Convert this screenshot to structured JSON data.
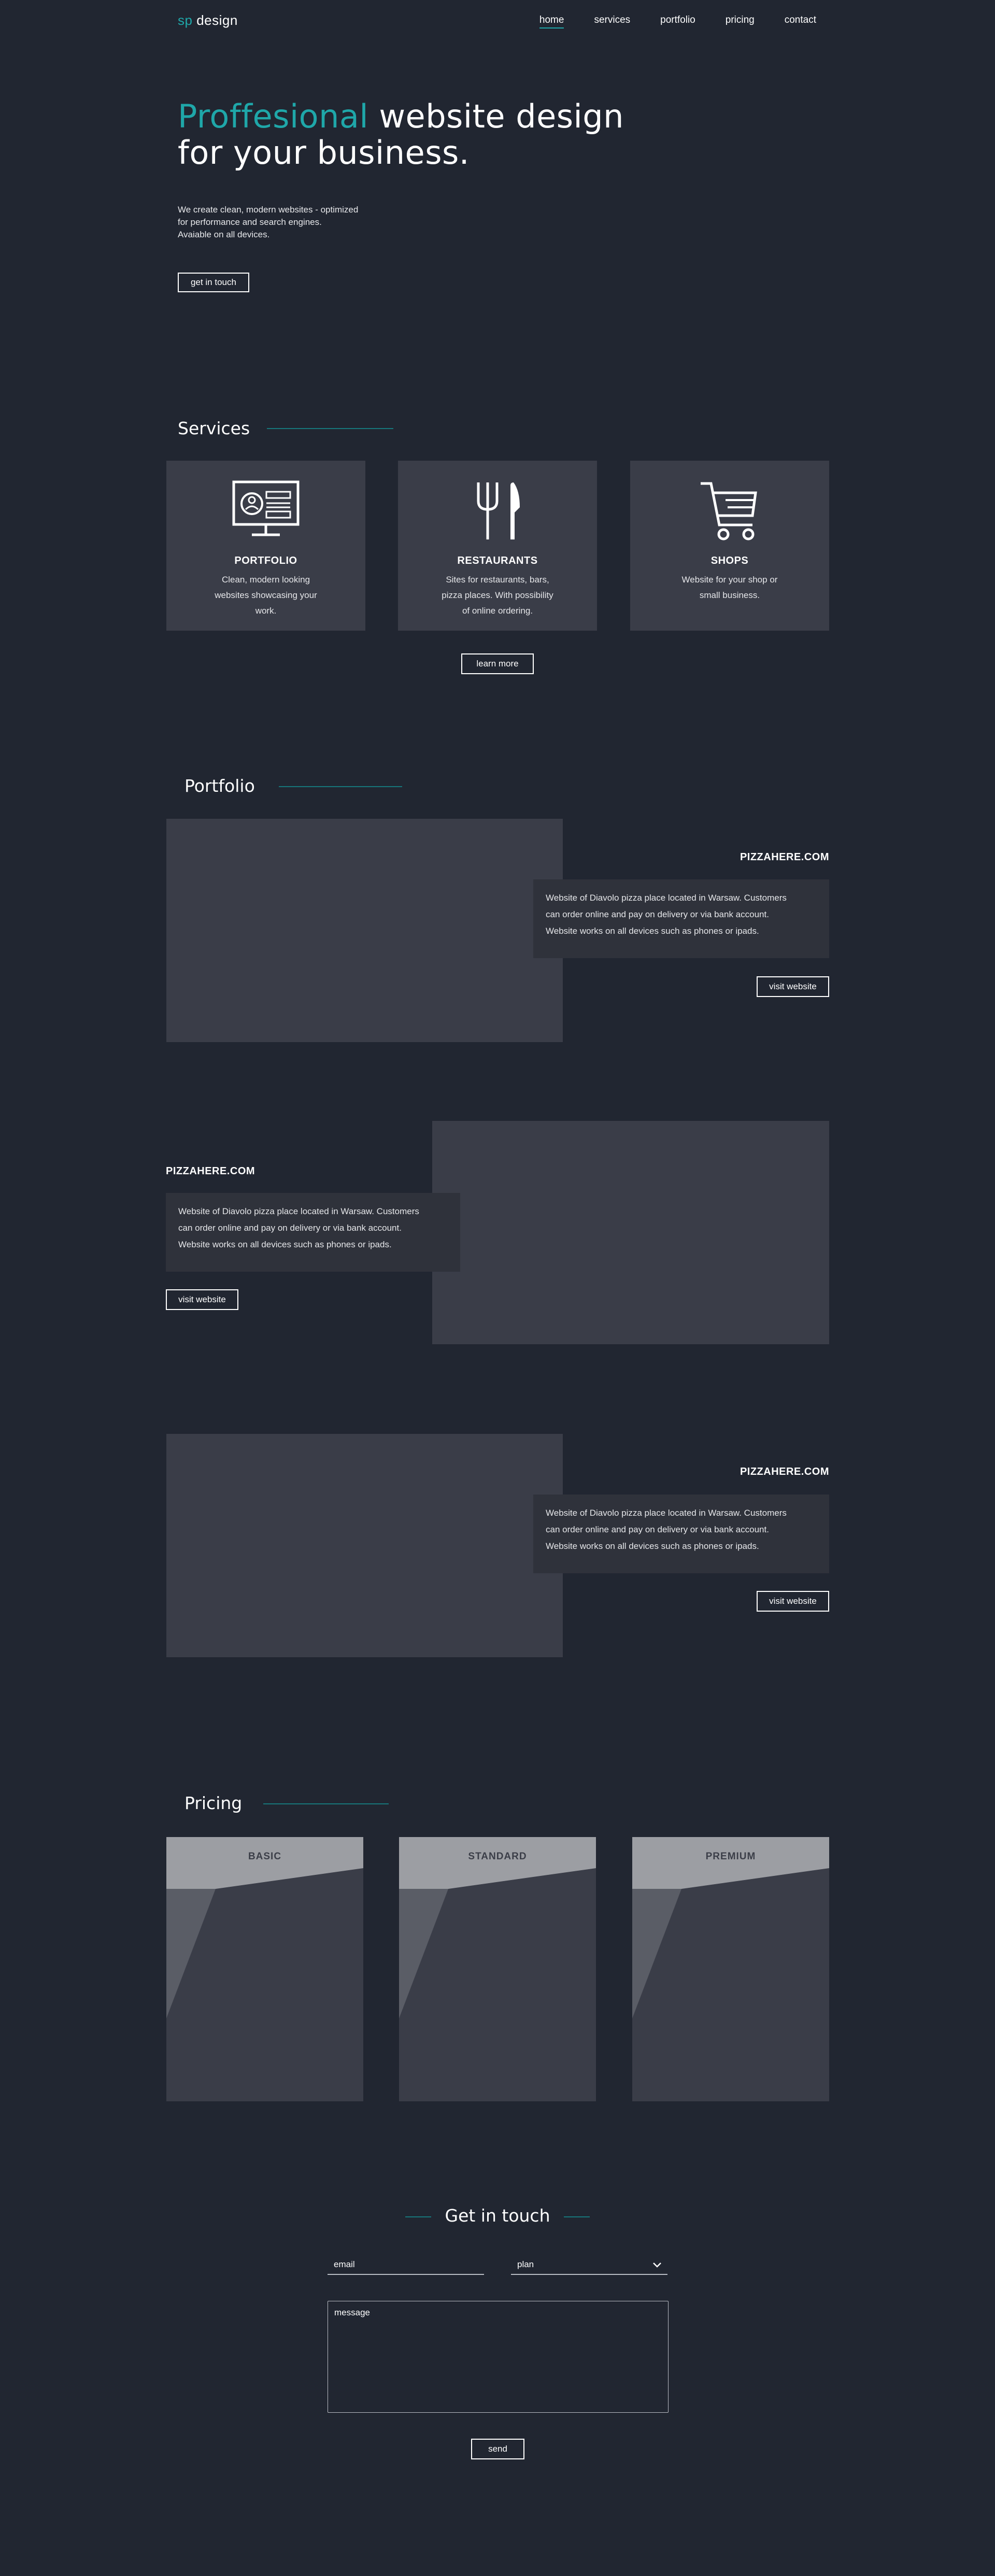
{
  "nav": {
    "logo_prefix": "sp",
    "logo_rest": " design",
    "items": [
      "home",
      "services",
      "portfolio",
      "pricing",
      "contact"
    ]
  },
  "hero": {
    "title_accent": "Proffesional",
    "title_rest_line1": " website design",
    "title_line2": "for your business.",
    "text_line1": "We create clean, modern websites - optimized",
    "text_line2": "for performance and search engines.",
    "text_line3": "Avaiable on all devices.",
    "cta": "get in touch"
  },
  "services": {
    "title": "Services",
    "cards": [
      {
        "icon": "monitor-icon",
        "title": "PORTFOLIO",
        "desc": [
          "Clean, modern looking",
          "websites showcasing your",
          "work."
        ]
      },
      {
        "icon": "fork-knife-icon",
        "title": "RESTAURANTS",
        "desc": [
          "Sites for restaurants, bars,",
          "pizza places. With possibility",
          "of online ordering."
        ]
      },
      {
        "icon": "cart-icon",
        "title": "SHOPS",
        "desc": [
          "Website for your shop or",
          "small business."
        ]
      }
    ],
    "learn_more": "learn more"
  },
  "portfolio": {
    "title": "Portfolio",
    "items": [
      {
        "domain": "PIZZAHERE.COM",
        "desc": [
          "Website of Diavolo pizza place located in Warsaw. Customers",
          "can order online and pay on delivery or via bank account.",
          "Website works on all devices such as phones or ipads."
        ],
        "button": "visit website"
      },
      {
        "domain": "PIZZAHERE.COM",
        "desc": [
          "Website of Diavolo pizza place located in Warsaw. Customers",
          "can order online and pay on delivery or via bank account.",
          "Website works on all devices such as phones or ipads."
        ],
        "button": "visit website"
      },
      {
        "domain": "PIZZAHERE.COM",
        "desc": [
          "Website of Diavolo pizza place located in Warsaw. Customers",
          "can order online and pay on delivery or via bank account.",
          "Website works on all devices such as phones or ipads."
        ],
        "button": "visit website"
      }
    ]
  },
  "pricing": {
    "title": "Pricing",
    "plans": [
      "BASIC",
      "STANDARD",
      "PREMIUM"
    ]
  },
  "contact": {
    "title": "Get in touch",
    "email_placeholder": "email",
    "plan_placeholder": "plan",
    "message_placeholder": "message",
    "send": "send"
  },
  "colors": {
    "background": "#212631",
    "accent": "#1fa7a9",
    "card": "#3a3d48"
  }
}
